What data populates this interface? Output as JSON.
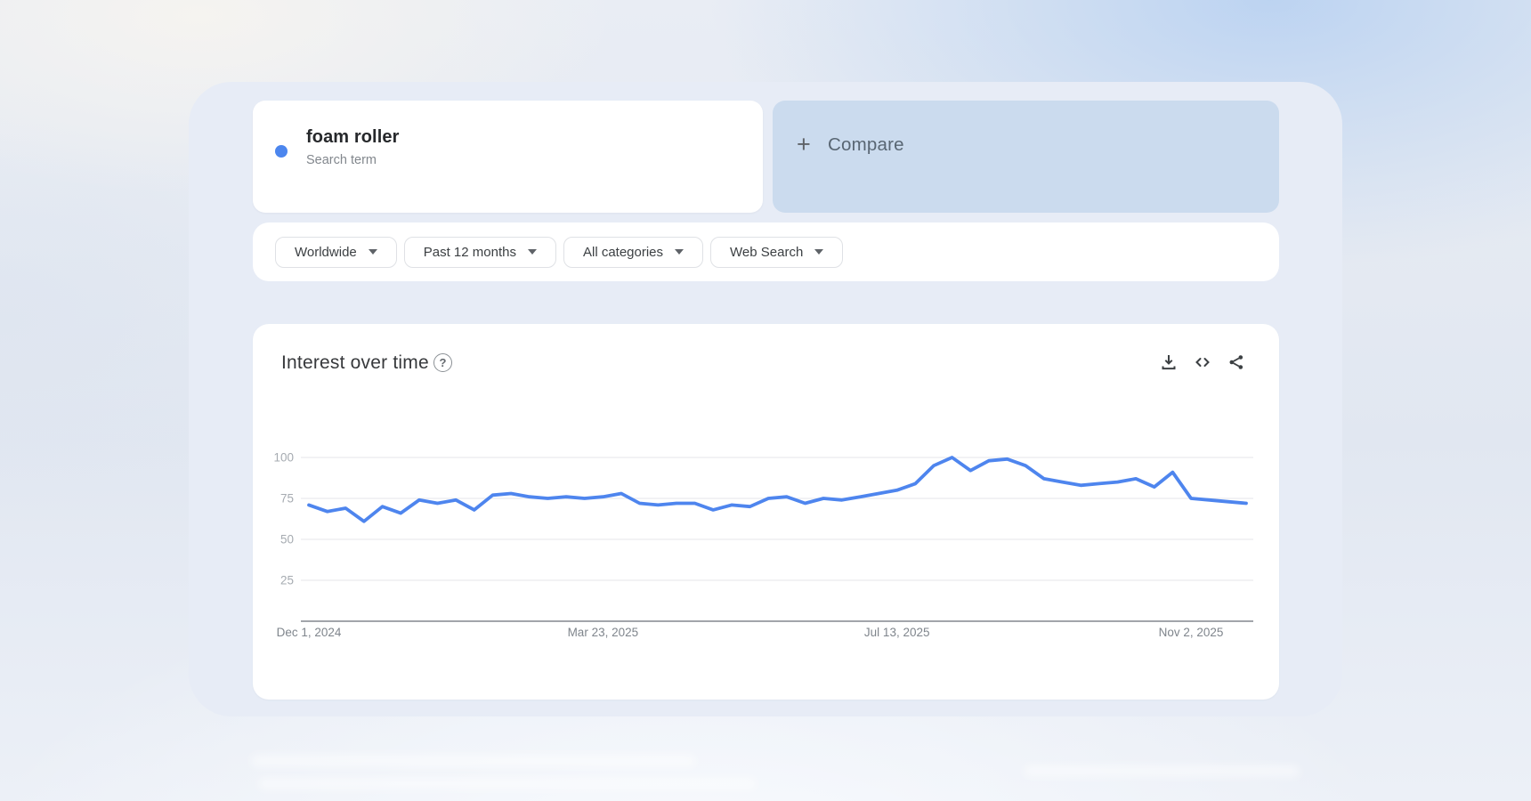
{
  "term_card": {
    "term": "foam roller",
    "subtitle": "Search term",
    "dot_color": "#4c86ee"
  },
  "compare_card": {
    "plus": "+",
    "label": "Compare"
  },
  "filters": {
    "items": [
      {
        "label": "Worldwide"
      },
      {
        "label": "Past 12 months"
      },
      {
        "label": "All categories"
      },
      {
        "label": "Web Search"
      }
    ]
  },
  "chart_card": {
    "title": "Interest over time",
    "help_glyph": "?"
  },
  "chart_data": {
    "type": "line",
    "title": "Interest over time",
    "series": [
      {
        "name": "foam roller",
        "values": [
          71,
          67,
          69,
          61,
          70,
          66,
          74,
          72,
          74,
          68,
          77,
          78,
          76,
          75,
          76,
          75,
          76,
          78,
          72,
          71,
          72,
          72,
          68,
          71,
          70,
          75,
          76,
          72,
          75,
          74,
          76,
          78,
          80,
          84,
          95,
          100,
          92,
          98,
          99,
          95,
          87,
          85,
          83,
          84,
          85,
          87,
          82,
          91,
          75,
          74,
          73,
          72
        ]
      }
    ],
    "x_tick_labels": [
      "Dec 1, 2024",
      "Mar 23, 2025",
      "Jul 13, 2025",
      "Nov 2, 2025"
    ],
    "x_tick_indices": [
      0,
      16,
      32,
      48
    ],
    "y_ticks": [
      25,
      50,
      75,
      100
    ],
    "ylim": [
      0,
      100
    ],
    "grid": true,
    "legend": "none",
    "line_color": "#4e85ee"
  }
}
